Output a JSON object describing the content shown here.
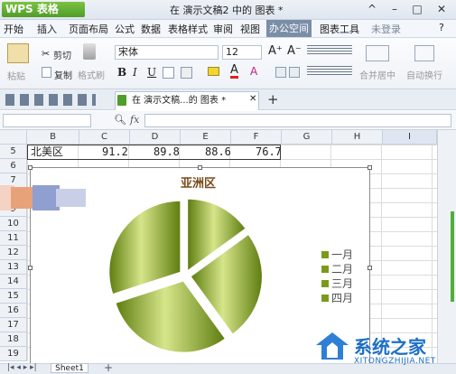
{
  "titlebar": {
    "app_name": "WPS 表格",
    "title": "在 演示文稿2 中的 图表 *",
    "controls": [
      "^",
      "–",
      "□",
      "✕"
    ]
  },
  "menubar": {
    "items": [
      "开始",
      "插入",
      "页面布局",
      "公式",
      "数据",
      "表格样式",
      "审阅",
      "视图",
      "办公空间",
      "图表工具"
    ],
    "active": "图表工具",
    "right": {
      "login": "未登录",
      "help": "?"
    }
  },
  "ribbon": {
    "paste": "粘贴",
    "cut": "剪切",
    "copy": "复制",
    "format_painter": "格式刷",
    "font_name": "宋体",
    "font_size": "12",
    "grow": "A⁺",
    "shrink": "A⁻",
    "bold": "B",
    "italic": "I",
    "underline": "U",
    "merge": "合并居中",
    "wrap": "自动换行"
  },
  "tabbar": {
    "doc_tab": "在 演示文稿...的 图表 *",
    "close": "✕",
    "add": "+"
  },
  "formula": {
    "fx": "fx",
    "zoom_icon": "magnifier-icon"
  },
  "sheet": {
    "columns": [
      "B",
      "C",
      "D",
      "E",
      "F",
      "G",
      "H",
      "I"
    ],
    "rows": [
      "5",
      "6",
      "7",
      "8",
      "9",
      "10",
      "11",
      "12",
      "13",
      "14",
      "15",
      "16",
      "17",
      "18",
      "19"
    ],
    "row5": {
      "label": "北美区",
      "values": [
        "91.2",
        "89.8",
        "88.6",
        "76.7"
      ]
    },
    "tab_label": "Sheet1"
  },
  "chart_data": {
    "type": "pie",
    "title": "亚洲区",
    "categories": [
      "一月",
      "二月",
      "三月",
      "四月"
    ],
    "values": [
      15,
      25,
      30,
      30
    ],
    "legend_position": "right",
    "colors": {
      "fill_dark": "#5f7e10",
      "fill_light": "#d6e58a",
      "legend": "#7b9a1c",
      "title": "#7a4a1c"
    }
  },
  "watermark": {
    "text": "系统之家",
    "url_text": "XITONGZHIJIA.NET"
  }
}
